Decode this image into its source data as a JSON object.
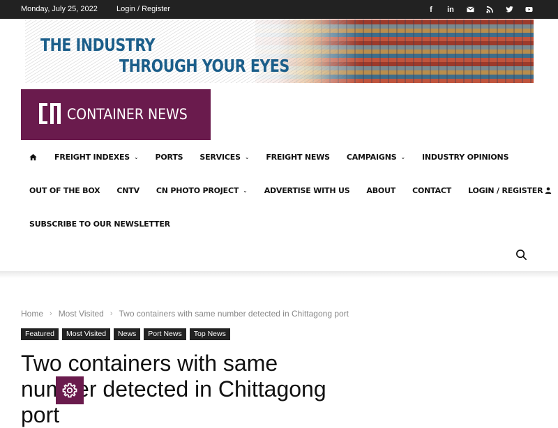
{
  "topbar": {
    "date": "Monday, July 25, 2022",
    "login": "Login / Register",
    "social_icons": [
      "facebook-icon",
      "linkedin-icon",
      "mail-icon",
      "rss-icon",
      "twitter-icon",
      "youtube-icon"
    ]
  },
  "banner": {
    "line1": "THE INDUSTRY",
    "line2": "THROUGH YOUR EYES"
  },
  "logo": {
    "text": "CONTAINER NEWS",
    "color": "#6a1b4d"
  },
  "nav": {
    "row1": [
      {
        "label": "FREIGHT INDEXES",
        "dropdown": true
      },
      {
        "label": "PORTS",
        "dropdown": false
      },
      {
        "label": "SERVICES",
        "dropdown": true
      },
      {
        "label": "FREIGHT NEWS",
        "dropdown": false
      },
      {
        "label": "CAMPAIGNS",
        "dropdown": true
      },
      {
        "label": "INDUSTRY OPINIONS",
        "dropdown": false
      }
    ],
    "row2": [
      {
        "label": "OUT OF THE BOX",
        "dropdown": false
      },
      {
        "label": "CNTV",
        "dropdown": false
      },
      {
        "label": "CN PHOTO PROJECT",
        "dropdown": true
      },
      {
        "label": "ADVERTISE WITH US",
        "dropdown": false
      },
      {
        "label": "ABOUT",
        "dropdown": false
      },
      {
        "label": "CONTACT",
        "dropdown": false
      },
      {
        "label": "LOGIN / REGISTER",
        "dropdown": false
      }
    ],
    "row3": [
      {
        "label": "SUBSCRIBE TO OUR NEWSLETTER",
        "dropdown": false
      }
    ]
  },
  "breadcrumb": {
    "home": "Home",
    "section": "Most Visited",
    "current": "Two containers with same number detected in Chittagong port"
  },
  "tags": [
    "Featured",
    "Most Visited",
    "News",
    "Port News",
    "Top News"
  ],
  "article": {
    "title": "Two containers with same number detected in Chittagong port"
  }
}
